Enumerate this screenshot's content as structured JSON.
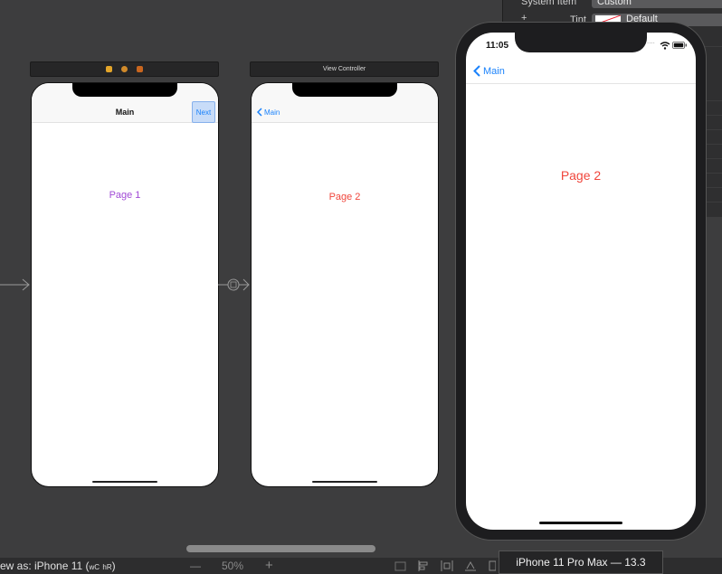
{
  "inspector": {
    "system_item_label": "System Item",
    "system_item_value": "Custom",
    "tint_label": "Tint",
    "tint_value": "Default",
    "add_symbol": "+"
  },
  "scene_one": {
    "nav_title": "Main",
    "next_button": "Next",
    "content_label": "Page 1",
    "content_color": "#a14bd6"
  },
  "scene_two": {
    "bar_title": "View Controller",
    "back_label": "Main",
    "content_label": "Page 2",
    "content_color": "#f0463c"
  },
  "simulator": {
    "time": "11:05",
    "signal": "....",
    "back_label": "Main",
    "content_label": "Page 2",
    "tooltip": "iPhone 11 Pro Max — 13.3"
  },
  "bottom": {
    "view_as_prefix": "ew as: iPhone 11 (",
    "size_w": "wC",
    "size_h": "hR",
    "view_as_suffix": ")",
    "zoom_out": "—",
    "zoom": "50%",
    "zoom_in": "+"
  },
  "colors": {
    "ios_blue": "#1a82fb",
    "canvas": "#3d3d3e"
  }
}
